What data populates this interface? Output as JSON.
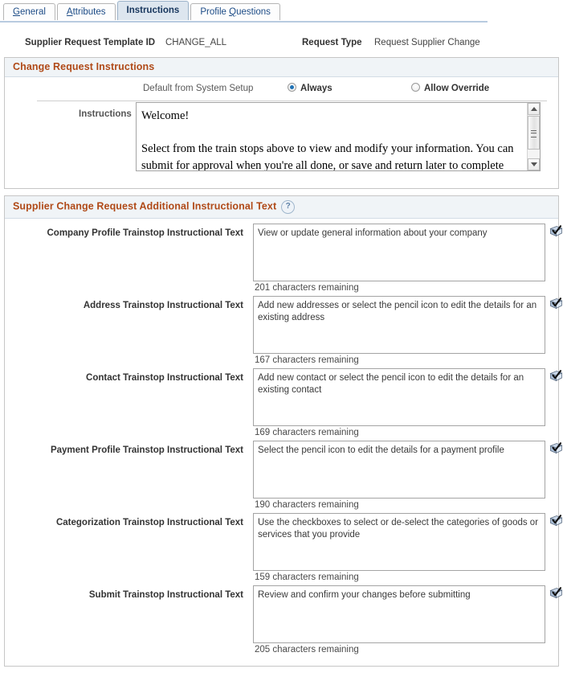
{
  "tabs": [
    {
      "label": "General",
      "accel": "G",
      "active": false
    },
    {
      "label": "Attributes",
      "accel": "A",
      "active": false
    },
    {
      "label": "Instructions",
      "accel": "",
      "active": true
    },
    {
      "label": "Profile Questions",
      "accel": "Q",
      "active": false
    }
  ],
  "header": {
    "template_id_label": "Supplier Request Template ID",
    "template_id_value": "CHANGE_ALL",
    "request_type_label": "Request Type",
    "request_type_value": "Request Supplier Change"
  },
  "change_request_instructions": {
    "title": "Change Request Instructions",
    "default_label": "Default from System Setup",
    "radio_always": "Always",
    "radio_allow_override": "Allow Override",
    "selected": "Always",
    "instructions_label": "Instructions",
    "instructions_value": "Welcome!\n\nSelect from the train stops above to view and modify your information. You can submit for approval when you're all done, or save and return later to complete"
  },
  "additional_text": {
    "title": "Supplier Change Request Additional Instructional Text",
    "help_icon": "help-question-icon",
    "rows": [
      {
        "label": "Company Profile Trainstop Instructional Text",
        "value": "View or update general information about your company",
        "remaining": "201 characters remaining",
        "spell_icon": "spellcheck-icon"
      },
      {
        "label": "Address Trainstop Instructional Text",
        "value": "Add new addresses or select the pencil icon to edit the details for an existing address",
        "remaining": "167 characters remaining",
        "spell_icon": "spellcheck-icon"
      },
      {
        "label": "Contact Trainstop Instructional Text",
        "value": "Add new contact or select the pencil icon to edit the details for an existing contact",
        "remaining": "169 characters remaining",
        "spell_icon": "spellcheck-icon"
      },
      {
        "label": "Payment Profile Trainstop Instructional Text",
        "value": "Select the pencil icon to edit the details for a payment profile",
        "remaining": "190 characters remaining",
        "spell_icon": "spellcheck-icon"
      },
      {
        "label": "Categorization Trainstop Instructional Text",
        "value": "Use the checkboxes to select or de-select the categories of goods or services  that you provide",
        "remaining": "159 characters remaining",
        "spell_icon": "spellcheck-icon"
      },
      {
        "label": "Submit Trainstop Instructional Text",
        "value": "Review and confirm your changes before submitting",
        "remaining": "205 characters remaining",
        "spell_icon": "spellcheck-icon"
      }
    ]
  },
  "colors": {
    "group_title": "#b04a18",
    "tab_link": "#1c4b86",
    "radio_dot": "#1f72b5",
    "tab_active_bg": "#dde6ef"
  }
}
